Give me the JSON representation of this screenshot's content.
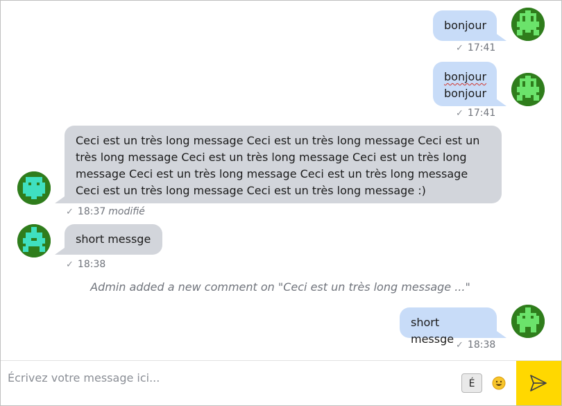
{
  "messages": [
    {
      "id": "m1",
      "author": "me",
      "text_lines": [
        "bonjour"
      ],
      "time": "17:41",
      "edited": ""
    },
    {
      "id": "m2",
      "author": "me",
      "text_lines": [
        "bonjour",
        "bonjour"
      ],
      "time": "17:41",
      "edited": ""
    },
    {
      "id": "m3",
      "author": "other",
      "text_lines": [
        "Ceci est un très long message Ceci est un très long message Ceci est un",
        "très long message Ceci est un très long message Ceci est un très long",
        "message Ceci est un très long message Ceci est un très long message",
        "Ceci est un très long message Ceci est un très long message :)"
      ],
      "time": "18:37",
      "edited": "modifié"
    },
    {
      "id": "m4",
      "author": "other",
      "text_lines": [
        "short messge"
      ],
      "time": "18:38",
      "edited": ""
    },
    {
      "id": "m5",
      "author": "me",
      "text_lines": [
        "short messge"
      ],
      "time": "18:38",
      "edited": ""
    }
  ],
  "system_message": "Admin added a new comment on \"Ceci est un très long message ...\"",
  "check_glyph": "✓",
  "composer": {
    "placeholder": "Écrivez votre message ici...",
    "accent_key": "É",
    "emoji": "😀"
  },
  "colors": {
    "own_bubble": "#c8dcf8",
    "other_bubble": "#d2d5db",
    "send_button": "#ffd800",
    "avatar_bg": "#2f7d1c",
    "avatar_own_fg": "#6be36b",
    "avatar_other_fg": "#3fe0c0"
  }
}
